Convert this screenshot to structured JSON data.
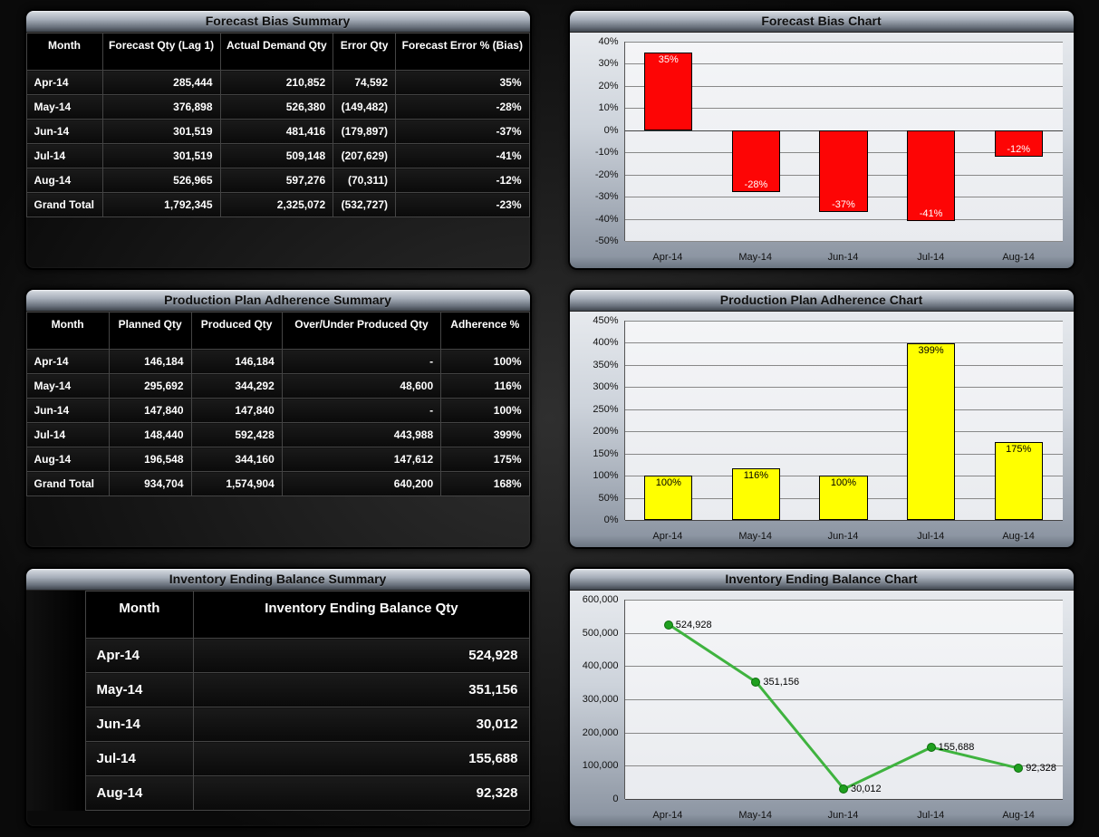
{
  "forecast_bias": {
    "title": "Forecast Bias Summary",
    "headers": [
      "Month",
      "Forecast Qty (Lag 1)",
      "Actual Demand Qty",
      "Error Qty",
      "Forecast Error % (Bias)"
    ],
    "rows": [
      [
        "Apr-14",
        "285,444",
        "210,852",
        "74,592",
        "35%"
      ],
      [
        "May-14",
        "376,898",
        "526,380",
        "(149,482)",
        "-28%"
      ],
      [
        "Jun-14",
        "301,519",
        "481,416",
        "(179,897)",
        "-37%"
      ],
      [
        "Jul-14",
        "301,519",
        "509,148",
        "(207,629)",
        "-41%"
      ],
      [
        "Aug-14",
        "526,965",
        "597,276",
        "(70,311)",
        "-12%"
      ]
    ],
    "total": [
      "Grand Total",
      "1,792,345",
      "2,325,072",
      "(532,727)",
      "-23%"
    ]
  },
  "production": {
    "title": "Production Plan Adherence Summary",
    "headers": [
      "Month",
      "Planned Qty",
      "Produced Qty",
      "Over/Under Produced Qty",
      "Adherence %"
    ],
    "rows": [
      [
        "Apr-14",
        "146,184",
        "146,184",
        "-",
        "100%"
      ],
      [
        "May-14",
        "295,692",
        "344,292",
        "48,600",
        "116%"
      ],
      [
        "Jun-14",
        "147,840",
        "147,840",
        "-",
        "100%"
      ],
      [
        "Jul-14",
        "148,440",
        "592,428",
        "443,988",
        "399%"
      ],
      [
        "Aug-14",
        "196,548",
        "344,160",
        "147,612",
        "175%"
      ]
    ],
    "total": [
      "Grand Total",
      "934,704",
      "1,574,904",
      "640,200",
      "168%"
    ]
  },
  "inventory": {
    "title": "Inventory Ending Balance Summary",
    "headers": [
      "Month",
      "Inventory Ending Balance Qty"
    ],
    "rows": [
      [
        "Apr-14",
        "524,928"
      ],
      [
        "May-14",
        "351,156"
      ],
      [
        "Jun-14",
        "30,012"
      ],
      [
        "Jul-14",
        "155,688"
      ],
      [
        "Aug-14",
        "92,328"
      ]
    ]
  },
  "chart_data": [
    {
      "type": "bar",
      "title": "Forecast Bias Chart",
      "categories": [
        "Apr-14",
        "May-14",
        "Jun-14",
        "Jul-14",
        "Aug-14"
      ],
      "values": [
        35,
        -28,
        -37,
        -41,
        -12
      ],
      "value_labels": [
        "35%",
        "-28%",
        "-37%",
        "-41%",
        "-12%"
      ],
      "ylabel": "",
      "ylim": [
        -50,
        40
      ],
      "ystep": 10,
      "ysuffix": "%",
      "color": "red"
    },
    {
      "type": "bar",
      "title": "Production Plan Adherence Chart",
      "categories": [
        "Apr-14",
        "May-14",
        "Jun-14",
        "Jul-14",
        "Aug-14"
      ],
      "values": [
        100,
        116,
        100,
        399,
        175
      ],
      "value_labels": [
        "100%",
        "116%",
        "100%",
        "399%",
        "175%"
      ],
      "ylim": [
        0,
        450
      ],
      "ystep": 50,
      "ysuffix": "%",
      "color": "yellow"
    },
    {
      "type": "line",
      "title": "Inventory Ending Balance Chart",
      "categories": [
        "Apr-14",
        "May-14",
        "Jun-14",
        "Jul-14",
        "Aug-14"
      ],
      "values": [
        524928,
        351156,
        30012,
        155688,
        92328
      ],
      "value_labels": [
        "524,928",
        "351,156",
        "30,012",
        "155,688",
        "92,328"
      ],
      "ylim": [
        0,
        600000
      ],
      "ystep": 100000,
      "ysuffix": "",
      "color": "green"
    }
  ]
}
